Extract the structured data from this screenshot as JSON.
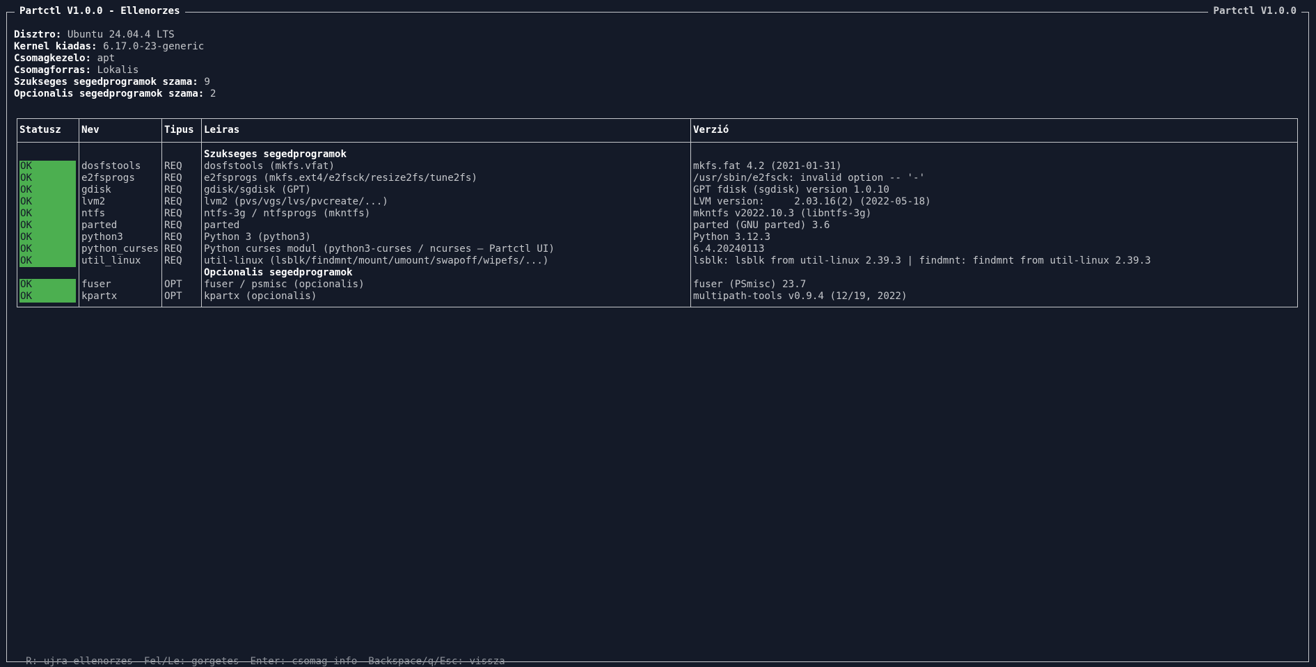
{
  "window": {
    "title": "Partctl V1.0.0 - Ellenorzes",
    "title_right": "Partctl V1.0.0"
  },
  "info": [
    {
      "label": "Disztro:",
      "value": "Ubuntu 24.04.4 LTS"
    },
    {
      "label": "Kernel kiadas:",
      "value": "6.17.0-23-generic"
    },
    {
      "label": "Csomagkezelo:",
      "value": "apt"
    },
    {
      "label": "Csomagforras:",
      "value": "Lokalis"
    },
    {
      "label": "Szukseges segedprogramok szama:",
      "value": "9"
    },
    {
      "label": "Opcionalis segedprogramok szama:",
      "value": "2"
    }
  ],
  "table": {
    "headers": {
      "status": "Statusz",
      "name": "Nev",
      "type": "Tipus",
      "desc": "Leiras",
      "version": "Verzió"
    },
    "group_required": "Szukseges segedprogramok",
    "group_optional": "Opcionalis segedprogramok",
    "required_rows": [
      {
        "status": "OK",
        "name": "dosfstools",
        "type": "REQ",
        "desc": "dosfstools (mkfs.vfat)",
        "version": "mkfs.fat 4.2 (2021-01-31)"
      },
      {
        "status": "OK",
        "name": "e2fsprogs",
        "type": "REQ",
        "desc": "e2fsprogs (mkfs.ext4/e2fsck/resize2fs/tune2fs)",
        "version": "/usr/sbin/e2fsck: invalid option -- '-'"
      },
      {
        "status": "OK",
        "name": "gdisk",
        "type": "REQ",
        "desc": "gdisk/sgdisk (GPT)",
        "version": "GPT fdisk (sgdisk) version 1.0.10"
      },
      {
        "status": "OK",
        "name": "lvm2",
        "type": "REQ",
        "desc": "lvm2 (pvs/vgs/lvs/pvcreate/...)",
        "version": "LVM version:     2.03.16(2) (2022-05-18)"
      },
      {
        "status": "OK",
        "name": "ntfs",
        "type": "REQ",
        "desc": "ntfs-3g / ntfsprogs (mkntfs)",
        "version": "mkntfs v2022.10.3 (libntfs-3g)"
      },
      {
        "status": "OK",
        "name": "parted",
        "type": "REQ",
        "desc": "parted",
        "version": "parted (GNU parted) 3.6"
      },
      {
        "status": "OK",
        "name": "python3",
        "type": "REQ",
        "desc": "Python 3 (python3)",
        "version": "Python 3.12.3"
      },
      {
        "status": "OK",
        "name": "python_curses",
        "type": "REQ",
        "desc": "Python curses modul (python3-curses / ncurses – Partctl UI)",
        "version": "6.4.20240113"
      },
      {
        "status": "OK",
        "name": "util_linux",
        "type": "REQ",
        "desc": "util-linux (lsblk/findmnt/mount/umount/swapoff/wipefs/...)",
        "version": "lsblk: lsblk from util-linux 2.39.3 | findmnt: findmnt from util-linux 2.39.3"
      }
    ],
    "optional_rows": [
      {
        "status": "OK",
        "name": "fuser",
        "type": "OPT",
        "desc": "fuser / psmisc (opcionalis)",
        "version": "fuser (PSmisc) 23.7"
      },
      {
        "status": "OK",
        "name": "kpartx",
        "type": "OPT",
        "desc": "kpartx (opcionalis)",
        "version": "multipath-tools v0.9.4 (12/19, 2022)"
      }
    ]
  },
  "footer": {
    "hints": [
      "R: ujra ellenorzes",
      "Fel/Le: gorgetes",
      "Enter: csomag info",
      "Backspace/q/Esc: vissza"
    ]
  },
  "colors": {
    "background": "#141a28",
    "ok_badge": "#4caf50",
    "border": "#c6c8cc"
  }
}
